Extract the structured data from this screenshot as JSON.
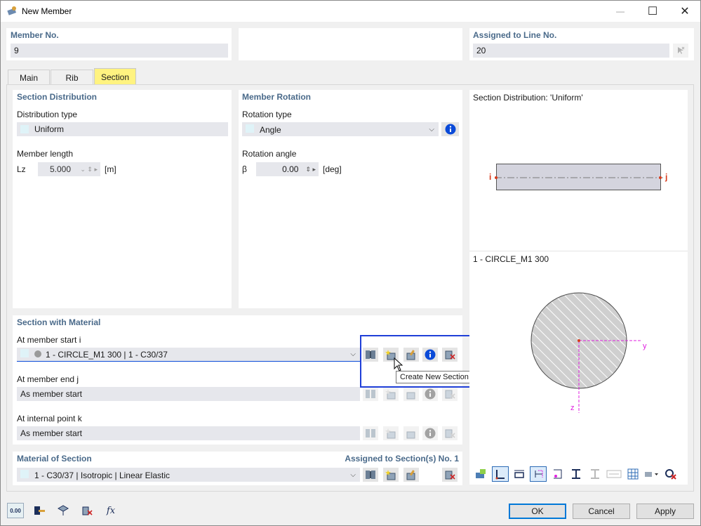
{
  "window": {
    "title": "New Member",
    "minimize": "—",
    "maximize": "☐",
    "close": "✕"
  },
  "top": {
    "member_no_label": "Member No.",
    "member_no_value": "9",
    "assigned_line_label": "Assigned to Line No.",
    "assigned_line_value": "20"
  },
  "tabs": [
    {
      "label": "Main",
      "active": false
    },
    {
      "label": "Rib",
      "active": false
    },
    {
      "label": "Section",
      "active": true
    }
  ],
  "section_distribution": {
    "header": "Section Distribution",
    "type_label": "Distribution type",
    "type_value": "Uniform",
    "length_label": "Member length",
    "length_symbol": "Lz",
    "length_value": "5.000",
    "length_unit": "[m]"
  },
  "member_rotation": {
    "header": "Member Rotation",
    "type_label": "Rotation type",
    "type_value": "Angle",
    "angle_label": "Rotation angle",
    "angle_symbol": "β",
    "angle_value": "0.00",
    "angle_unit": "[deg]"
  },
  "section_with_material": {
    "header": "Section with Material",
    "start_label": "At member start i",
    "start_value": "1 - CIRCLE_M1 300 | 1 - C30/37",
    "end_label": "At member end j",
    "end_value": "As member start",
    "internal_label": "At internal point k",
    "internal_value": "As member start",
    "tooltip": "Create New Section for Member Start..."
  },
  "material_of_section": {
    "header": "Material of Section",
    "assigned_label": "Assigned to Section(s) No. 1",
    "value": "1 - C30/37 | Isotropic | Linear Elastic"
  },
  "preview": {
    "distribution_title": "Section Distribution: 'Uniform'",
    "node_i": "i",
    "node_j": "j",
    "section_title": "1 - CIRCLE_M1 300",
    "axis_y": "y",
    "axis_z": "z"
  },
  "buttons": {
    "ok": "OK",
    "cancel": "Cancel",
    "apply": "Apply"
  },
  "bottom_icons": {
    "units_label": "0.00"
  },
  "colors": {
    "accent_tab": "#fff380",
    "header_text": "#4a6a8a",
    "highlight_box": "#1f3fd8",
    "axis_magenta": "#e020e0",
    "node_red": "#d83a1a"
  }
}
